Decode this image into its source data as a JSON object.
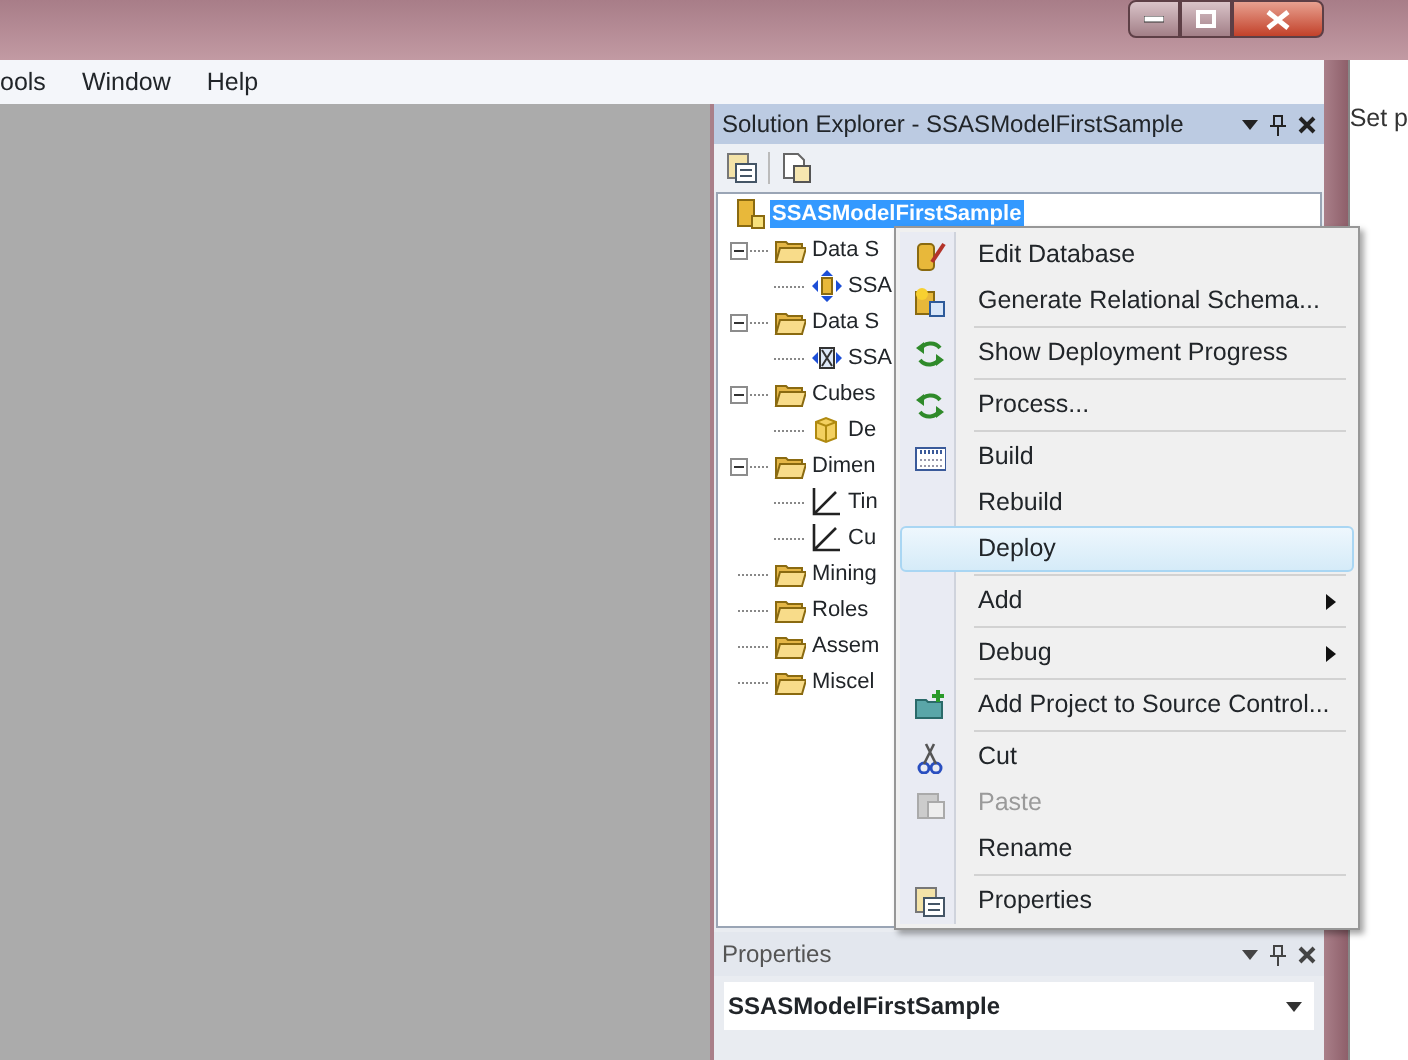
{
  "menu_bar": {
    "items": [
      "ools",
      "Window",
      "Help"
    ]
  },
  "background_window": {
    "text": "Set p"
  },
  "solution_explorer": {
    "title": "Solution Explorer - SSASModelFirstSample",
    "tree": [
      {
        "label": "SSASModelFirstSample",
        "kind": "project",
        "selected": true,
        "children": [
          {
            "label": "Data S",
            "kind": "folder",
            "selected": false,
            "expanded": true,
            "children": [
              {
                "label": "SSA",
                "kind": "data-source",
                "selected": false
              }
            ]
          },
          {
            "label": "Data S",
            "kind": "folder",
            "selected": false,
            "expanded": true,
            "children": [
              {
                "label": "SSA",
                "kind": "data-source-view",
                "selected": false
              }
            ]
          },
          {
            "label": "Cubes",
            "kind": "folder",
            "selected": false,
            "expanded": true,
            "children": [
              {
                "label": "De",
                "kind": "cube",
                "selected": false
              }
            ]
          },
          {
            "label": "Dimen",
            "kind": "folder",
            "selected": false,
            "expanded": true,
            "children": [
              {
                "label": "Tin",
                "kind": "dimension",
                "selected": false
              },
              {
                "label": "Cu",
                "kind": "dimension",
                "selected": false
              }
            ]
          },
          {
            "label": "Mining",
            "kind": "folder",
            "selected": false
          },
          {
            "label": "Roles",
            "kind": "folder",
            "selected": false
          },
          {
            "label": "Assem",
            "kind": "folder",
            "selected": false
          },
          {
            "label": "Miscel",
            "kind": "folder",
            "selected": false
          }
        ]
      }
    ]
  },
  "context_menu": [
    {
      "kind": "item",
      "label": "Edit Database",
      "selected": false,
      "disabled": false
    },
    {
      "kind": "item",
      "label": "Generate Relational Schema...",
      "selected": false,
      "disabled": false
    },
    {
      "kind": "separator"
    },
    {
      "kind": "item",
      "label": "Show Deployment Progress",
      "selected": false,
      "disabled": false
    },
    {
      "kind": "separator"
    },
    {
      "kind": "item",
      "label": "Process...",
      "selected": false,
      "disabled": false
    },
    {
      "kind": "separator"
    },
    {
      "kind": "item",
      "label": "Build",
      "selected": false,
      "disabled": false
    },
    {
      "kind": "item",
      "label": "Rebuild",
      "selected": false,
      "disabled": false
    },
    {
      "kind": "item",
      "label": "Deploy",
      "selected": true,
      "disabled": false
    },
    {
      "kind": "separator"
    },
    {
      "kind": "item",
      "label": "Add",
      "selected": false,
      "disabled": false,
      "submenu": true
    },
    {
      "kind": "separator"
    },
    {
      "kind": "item",
      "label": "Debug",
      "selected": false,
      "disabled": false,
      "submenu": true
    },
    {
      "kind": "separator"
    },
    {
      "kind": "item",
      "label": "Add Project to Source Control...",
      "selected": false,
      "disabled": false
    },
    {
      "kind": "separator"
    },
    {
      "kind": "item",
      "label": "Cut",
      "selected": false,
      "disabled": false
    },
    {
      "kind": "item",
      "label": "Paste",
      "selected": false,
      "disabled": true
    },
    {
      "kind": "item",
      "label": "Rename",
      "selected": false,
      "disabled": false
    },
    {
      "kind": "separator"
    },
    {
      "kind": "item",
      "label": "Properties",
      "selected": false,
      "disabled": false
    }
  ],
  "properties": {
    "title": "Properties",
    "object": "SSASModelFirstSample"
  }
}
